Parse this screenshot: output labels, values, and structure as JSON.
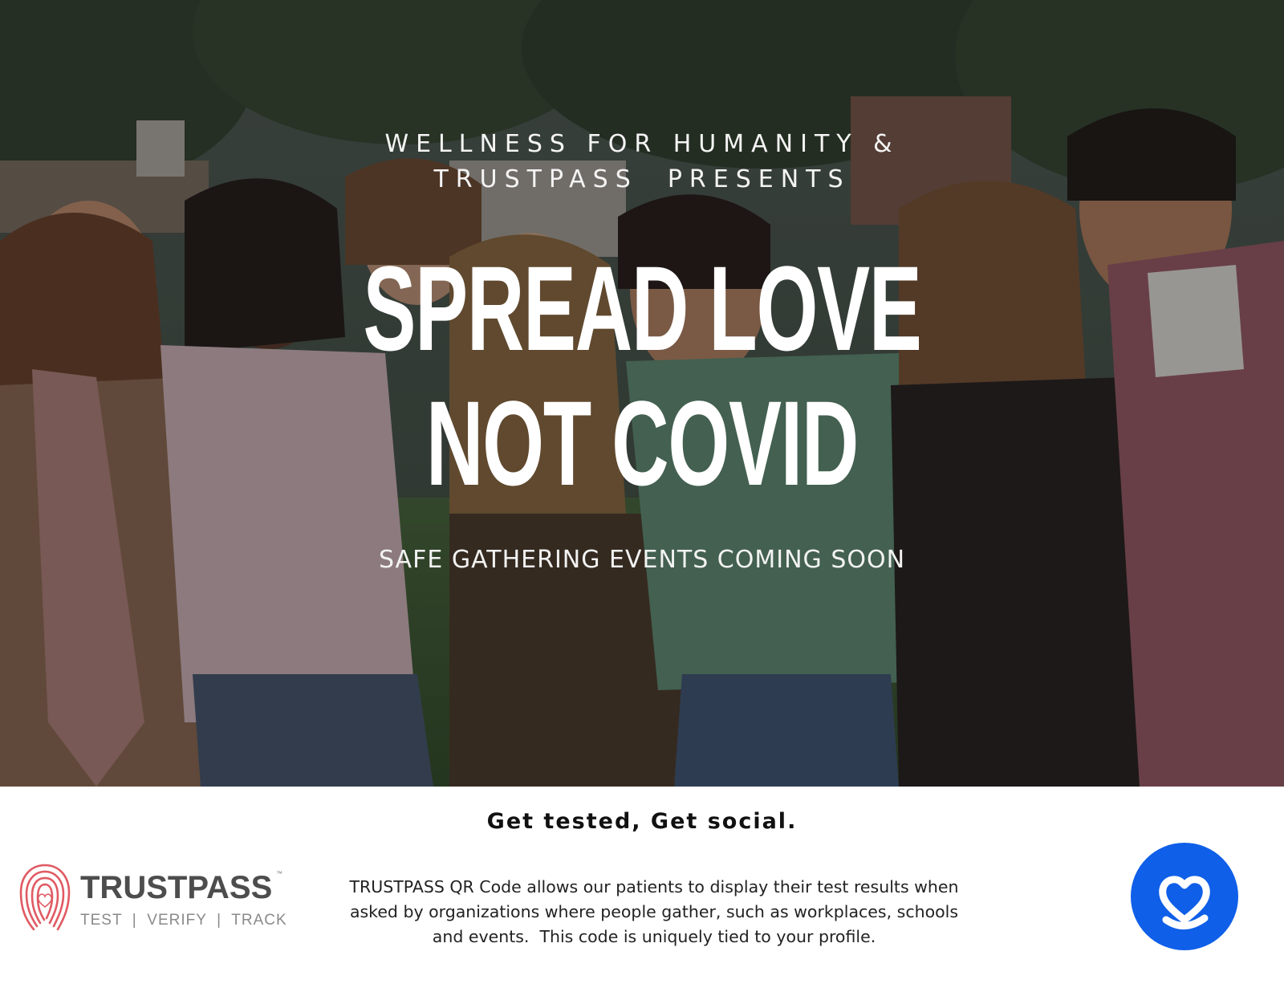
{
  "hero": {
    "presenter_line1": "WELLNESS FOR HUMANITY &",
    "presenter_line2": "TRUSTPASS  PRESENTS",
    "headline_line1": "SPREAD LOVE",
    "headline_line2": "NOT COVID",
    "subheadline": "SAFE GATHERING EVENTS COMING SOON",
    "photo_icon": "group-of-friends-photo"
  },
  "footer": {
    "tagline": "Get tested, Get social.",
    "brand": {
      "name": "TRUSTPASS",
      "trademark": "™",
      "motto": "TEST  |  VERIFY  |  TRACK",
      "logo_icon": "fingerprint-heart-icon",
      "logo_color": "#e05a63"
    },
    "description_lines": [
      "TRUSTPASS QR Code allows our patients to display their test results when",
      "asked by organizations where people gather, such as workplaces, schools",
      "and events.  This code is uniquely tied to your profile."
    ],
    "app_badge": {
      "icon": "heart-check-icon",
      "color": "#0f5fe8"
    }
  }
}
